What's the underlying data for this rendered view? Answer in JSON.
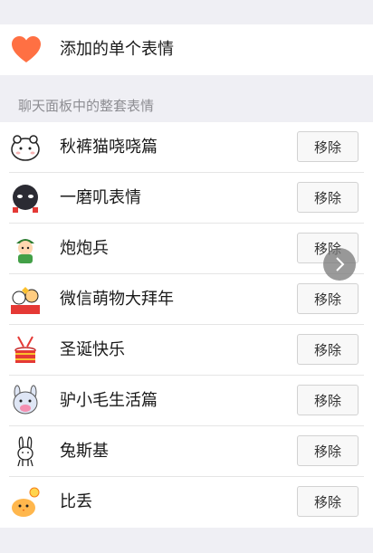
{
  "single": {
    "label": "添加的单个表情",
    "icon": "heart-icon",
    "color": "#ff7043"
  },
  "section": {
    "title": "聊天面板中的整套表情"
  },
  "remove_label": "移除",
  "packs": [
    {
      "name": "秋裤猫哓哓篇",
      "icon": "white-cat-icon"
    },
    {
      "name": "一磨叽表情",
      "icon": "dark-blob-icon"
    },
    {
      "name": "炮炮兵",
      "icon": "soldier-icon"
    },
    {
      "name": "微信萌物大拜年",
      "icon": "new-year-mascots-icon"
    },
    {
      "name": "圣诞快乐",
      "icon": "christmas-drum-icon"
    },
    {
      "name": "驴小毛生活篇",
      "icon": "donkey-icon"
    },
    {
      "name": "兔斯基",
      "icon": "rabbit-icon"
    },
    {
      "name": "比丢",
      "icon": "chick-icon"
    }
  ],
  "floating": {
    "icon": "chevron-right-icon"
  }
}
